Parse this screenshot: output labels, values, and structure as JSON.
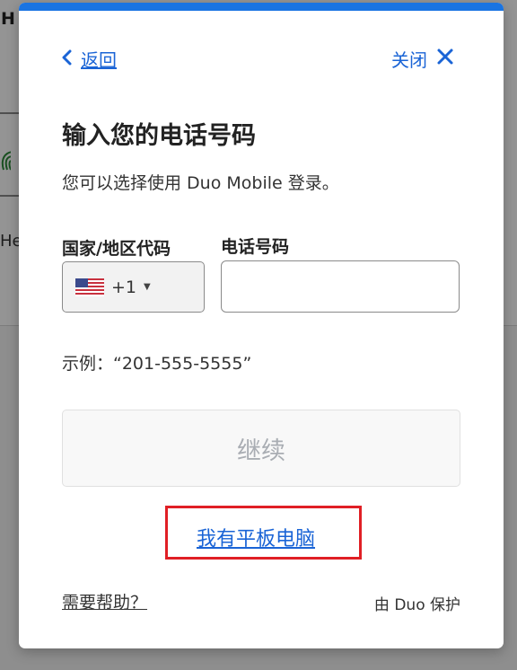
{
  "background": {
    "heading_fragment": "H",
    "text_fragment": "He"
  },
  "modal": {
    "back_label": "返回",
    "close_label": "关闭",
    "title": "输入您的电话号码",
    "subtitle": "您可以选择使用 Duo Mobile 登录。",
    "country_code_label": "国家/地区代码",
    "phone_label": "电话号码",
    "country_code": {
      "flag_icon": "us-flag-icon",
      "value": "+1"
    },
    "phone_input": {
      "value": "",
      "placeholder": ""
    },
    "example_text": "示例：“201-555-5555”",
    "continue_label": "继续",
    "tablet_link": "我有平板电脑",
    "help_link": "需要帮助？",
    "protected_by": "由 Duo 保护"
  },
  "colors": {
    "accent": "#1a74e2",
    "link": "#1a64d6",
    "highlight_box": "#e01f25"
  }
}
